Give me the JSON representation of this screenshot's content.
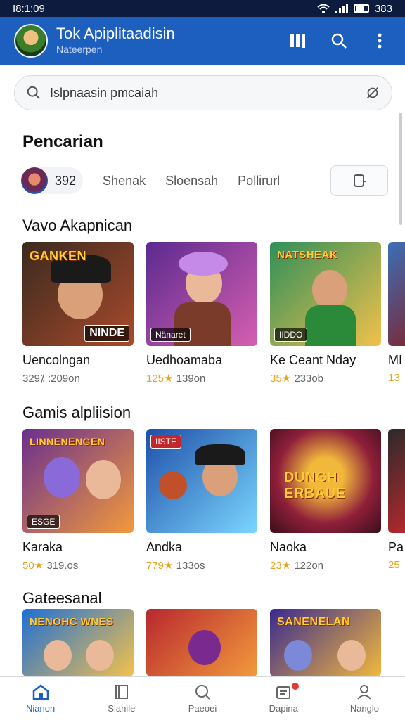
{
  "status_bar": {
    "time": "I8:1:09",
    "battery": "383"
  },
  "app_bar": {
    "title": "Tok Apiplitaadisin",
    "subtitle": "Nateerpen"
  },
  "search": {
    "placeholder": "Islpnaasin pmcaiah"
  },
  "heading": "Pencarian",
  "filters": {
    "first_chip_label": "392",
    "items": [
      "Shenak",
      "Sloensah",
      "Pollirurl"
    ]
  },
  "sections": [
    {
      "title": "Vavo Akapnican",
      "cards": [
        {
          "name": "Uencolngan",
          "meta": "329⁒ :209on",
          "banner": "GANKEN",
          "tag": "NINDE",
          "colors": [
            "#3a2a1f",
            "#a94a2b"
          ]
        },
        {
          "name": "Uedhoamaba",
          "rating": "125★",
          "meta": "139on",
          "tag": "Nänaret",
          "colors": [
            "#5b2a8f",
            "#d65fb1"
          ]
        },
        {
          "name": "Ke Ceant Nday",
          "rating": "35★",
          "meta": "233ob",
          "banner": "NATSHEAK",
          "tag": "IIDDO",
          "colors": [
            "#2f8f5a",
            "#f2c14b"
          ]
        }
      ],
      "partial": {
        "name": "MI",
        "rating": "13"
      }
    },
    {
      "title": "Gamis alpliision",
      "cards": [
        {
          "name": "Karaka",
          "rating": "50★",
          "meta": "319.os",
          "banner": "LINNENENGEN",
          "tag": "ESGE",
          "colors": [
            "#6a2f8f",
            "#f29a3c"
          ]
        },
        {
          "name": "Andka",
          "rating": "779★",
          "meta": "133os",
          "tag": "IISTE",
          "colors": [
            "#1f4fa8",
            "#7ad6ff"
          ]
        },
        {
          "name": "Naoka",
          "rating": "23★",
          "meta": "122on",
          "banner": "DUNGH ERBAUE",
          "colors": [
            "#8f1f3a",
            "#f2b83c"
          ]
        }
      ],
      "partial": {
        "name": "Pa",
        "rating": "25"
      }
    },
    {
      "title": "Gateesanal",
      "cards": [
        {
          "banner": "NENOHC WNES",
          "colors": [
            "#1f6fd6",
            "#f2c14b"
          ]
        },
        {
          "colors": [
            "#b8282e",
            "#f29a3c"
          ]
        },
        {
          "banner": "SANENELAN",
          "colors": [
            "#3a2a8f",
            "#f2b83c"
          ]
        }
      ]
    }
  ],
  "bottom_nav": [
    {
      "label": "Nianon",
      "icon": "home-icon",
      "active": true
    },
    {
      "label": "Slanile",
      "icon": "library-icon",
      "active": false
    },
    {
      "label": "Paeoei",
      "icon": "search-icon",
      "active": false
    },
    {
      "label": "Dapina",
      "icon": "inbox-icon",
      "active": false,
      "badge": true
    },
    {
      "label": "Nanglo",
      "icon": "profile-icon",
      "active": false
    }
  ],
  "colors": {
    "accent": "#1d5fbf",
    "status_bar": "#0d1b3e",
    "rating": "#e6a21a"
  }
}
